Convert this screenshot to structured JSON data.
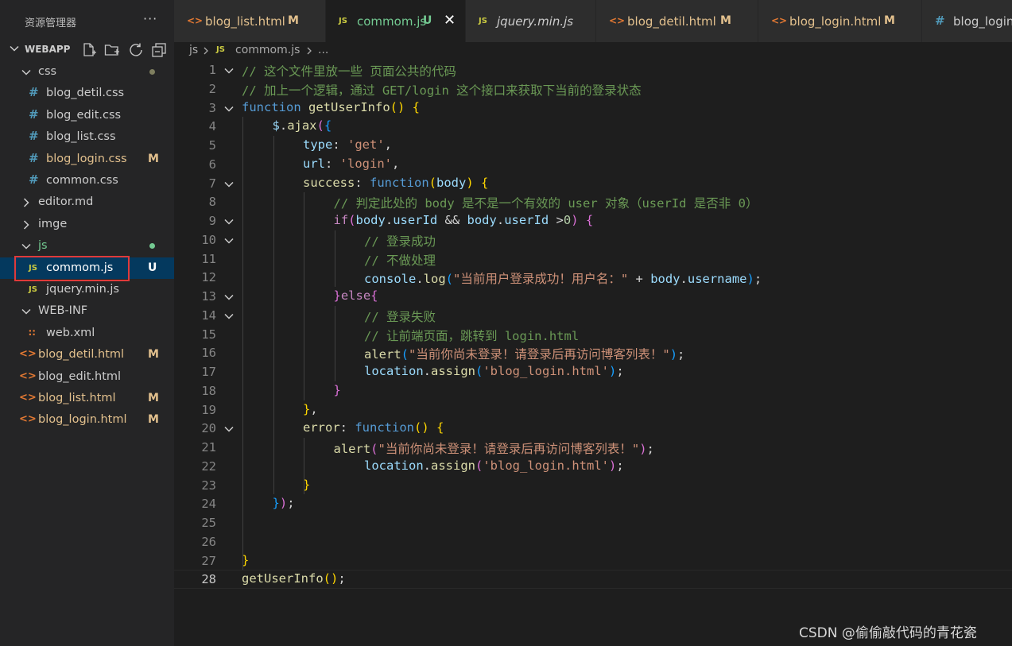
{
  "explorer": {
    "title": "资源管理器",
    "more": "···",
    "project": "WEBAPP",
    "toolbar_icons": [
      "new-file-icon",
      "new-folder-icon",
      "refresh-icon",
      "collapse-all-icon"
    ]
  },
  "tree": [
    {
      "label": "css",
      "type": "folder",
      "open": true,
      "depth": 1,
      "dot": true,
      "dot_color": "#7f7f5f"
    },
    {
      "label": "blog_detil.css",
      "type": "css",
      "depth": 2
    },
    {
      "label": "blog_edit.css",
      "type": "css",
      "depth": 2
    },
    {
      "label": "blog_list.css",
      "type": "css",
      "depth": 2
    },
    {
      "label": "blog_login.css",
      "type": "css",
      "depth": 2,
      "status": "M",
      "color": "#e2c08d"
    },
    {
      "label": "common.css",
      "type": "css",
      "depth": 2
    },
    {
      "label": "editor.md",
      "type": "folder",
      "open": false,
      "depth": 1
    },
    {
      "label": "imge",
      "type": "folder",
      "open": false,
      "depth": 1
    },
    {
      "label": "js",
      "type": "folder",
      "open": true,
      "depth": 1,
      "dot": true,
      "dot_color": "#73c991",
      "color": "#73c991"
    },
    {
      "label": "commom.js",
      "type": "js",
      "depth": 2,
      "status": "U",
      "color": "#ffffff",
      "active": true
    },
    {
      "label": "jquery.min.js",
      "type": "js",
      "depth": 2
    },
    {
      "label": "WEB-INF",
      "type": "folder",
      "open": true,
      "depth": 1
    },
    {
      "label": "web.xml",
      "type": "xml",
      "depth": 2
    },
    {
      "label": "blog_detil.html",
      "type": "html",
      "depth": 1,
      "status": "M",
      "color": "#e2c08d"
    },
    {
      "label": "blog_edit.html",
      "type": "html",
      "depth": 1
    },
    {
      "label": "blog_list.html",
      "type": "html",
      "depth": 1,
      "status": "M",
      "color": "#e2c08d"
    },
    {
      "label": "blog_login.html",
      "type": "html",
      "depth": 1,
      "status": "M",
      "color": "#e2c08d"
    }
  ],
  "tabs": [
    {
      "label": "blog_list.html",
      "icon": "html",
      "status": "M",
      "color": "#e2c08d"
    },
    {
      "label": "commom.js",
      "icon": "js",
      "status": "U",
      "color": "#73c991",
      "active": true,
      "close": "✕"
    },
    {
      "label": "jquery.min.js",
      "icon": "js",
      "italic": true
    },
    {
      "label": "blog_detil.html",
      "icon": "html",
      "status": "M",
      "color": "#e2c08d"
    },
    {
      "label": "blog_login.html",
      "icon": "html",
      "status": "M",
      "color": "#e2c08d"
    },
    {
      "label": "blog_login.css",
      "icon": "css"
    }
  ],
  "icons": {
    "js": "JS",
    "css": "#",
    "html": "<>",
    "xml": "∷"
  },
  "breadcrumb": {
    "folder": "js",
    "file": "commom.js",
    "rest": "..."
  },
  "code": {
    "current_line": 28,
    "lines": [
      {
        "n": 1,
        "fold": true,
        "indent": 0,
        "t": [
          [
            "c-cm",
            "// 这个文件里放一些 页面公共的代码"
          ]
        ]
      },
      {
        "n": 2,
        "indent": 0,
        "t": [
          [
            "c-cm",
            "// 加上一个逻辑，通过 GET/login 这个接口来获取下当前的登录状态"
          ]
        ]
      },
      {
        "n": 3,
        "fold": true,
        "indent": 0,
        "t": [
          [
            "c-kw",
            "function"
          ],
          [
            "",
            " "
          ],
          [
            "c-fn",
            "getUserInfo"
          ],
          [
            "b1",
            "()"
          ],
          [
            "",
            " "
          ],
          [
            "b1",
            "{"
          ]
        ]
      },
      {
        "n": 4,
        "indent": 1,
        "t": [
          [
            "c-pr",
            "$"
          ],
          [
            "",
            "."
          ],
          [
            "c-fn",
            "ajax"
          ],
          [
            "b2",
            "("
          ],
          [
            "b3",
            "{"
          ]
        ]
      },
      {
        "n": 5,
        "indent": 2,
        "t": [
          [
            "c-pr",
            "type"
          ],
          [
            "",
            ": "
          ],
          [
            "c-st",
            "'get'"
          ],
          [
            "",
            ","
          ]
        ]
      },
      {
        "n": 6,
        "indent": 2,
        "t": [
          [
            "c-pr",
            "url"
          ],
          [
            "",
            ": "
          ],
          [
            "c-st",
            "'login'"
          ],
          [
            "",
            ","
          ]
        ]
      },
      {
        "n": 7,
        "fold": true,
        "indent": 2,
        "t": [
          [
            "c-fn",
            "success"
          ],
          [
            "",
            ": "
          ],
          [
            "c-kw",
            "function"
          ],
          [
            "b1",
            "("
          ],
          [
            "c-pr",
            "body"
          ],
          [
            "b1",
            ")"
          ],
          [
            "",
            " "
          ],
          [
            "b1",
            "{"
          ]
        ]
      },
      {
        "n": 8,
        "indent": 3,
        "t": [
          [
            "c-cm",
            "// 判定此处的 body 是不是一个有效的 user 对象（userId 是否非 0）"
          ]
        ]
      },
      {
        "n": 9,
        "fold": true,
        "indent": 3,
        "t": [
          [
            "c-ct",
            "if"
          ],
          [
            "b2",
            "("
          ],
          [
            "c-pr",
            "body"
          ],
          [
            "",
            "."
          ],
          [
            "c-pr",
            "userId"
          ],
          [
            "",
            " && "
          ],
          [
            "c-pr",
            "body"
          ],
          [
            "",
            "."
          ],
          [
            "c-pr",
            "userId"
          ],
          [
            "",
            " >"
          ],
          [
            "c-nm",
            "0"
          ],
          [
            "b2",
            ")"
          ],
          [
            "",
            " "
          ],
          [
            "b2",
            "{"
          ]
        ]
      },
      {
        "n": 10,
        "fold": true,
        "indent": 4,
        "t": [
          [
            "c-cm",
            "// 登录成功"
          ]
        ]
      },
      {
        "n": 11,
        "indent": 4,
        "t": [
          [
            "c-cm",
            "// 不做处理"
          ]
        ]
      },
      {
        "n": 12,
        "indent": 4,
        "t": [
          [
            "c-pr",
            "console"
          ],
          [
            "",
            "."
          ],
          [
            "c-fn",
            "log"
          ],
          [
            "b3",
            "("
          ],
          [
            "c-st",
            "\"当前用户登录成功！用户名：\""
          ],
          [
            "",
            " + "
          ],
          [
            "c-pr",
            "body"
          ],
          [
            "",
            "."
          ],
          [
            "c-pr",
            "username"
          ],
          [
            "b3",
            ")"
          ],
          [
            "",
            ";"
          ]
        ]
      },
      {
        "n": 13,
        "fold": true,
        "indent": 3,
        "t": [
          [
            "b2",
            "}"
          ],
          [
            "c-ct",
            "else"
          ],
          [
            "b2",
            "{"
          ]
        ]
      },
      {
        "n": 14,
        "fold": true,
        "indent": 4,
        "t": [
          [
            "c-cm",
            "// 登录失败"
          ]
        ]
      },
      {
        "n": 15,
        "indent": 4,
        "t": [
          [
            "c-cm",
            "// 让前端页面，跳转到 login.html"
          ]
        ]
      },
      {
        "n": 16,
        "indent": 4,
        "t": [
          [
            "c-fn",
            "alert"
          ],
          [
            "b3",
            "("
          ],
          [
            "c-st",
            "\"当前你尚未登录！请登录后再访问博客列表！\""
          ],
          [
            "b3",
            ")"
          ],
          [
            "",
            ";"
          ]
        ]
      },
      {
        "n": 17,
        "indent": 4,
        "t": [
          [
            "c-pr",
            "location"
          ],
          [
            "",
            "."
          ],
          [
            "c-fn",
            "assign"
          ],
          [
            "b3",
            "("
          ],
          [
            "c-st",
            "'blog_login.html'"
          ],
          [
            "b3",
            ")"
          ],
          [
            "",
            ";"
          ]
        ]
      },
      {
        "n": 18,
        "indent": 3,
        "t": [
          [
            "b2",
            "}"
          ]
        ]
      },
      {
        "n": 19,
        "indent": 2,
        "t": [
          [
            "b1",
            "}"
          ],
          [
            "",
            ","
          ]
        ]
      },
      {
        "n": 20,
        "fold": true,
        "indent": 2,
        "t": [
          [
            "c-fn",
            "error"
          ],
          [
            "",
            ": "
          ],
          [
            "c-kw",
            "function"
          ],
          [
            "b1",
            "()"
          ],
          [
            "",
            " "
          ],
          [
            "b1",
            "{"
          ]
        ]
      },
      {
        "n": 21,
        "indent": 3,
        "t": [
          [
            "c-fn",
            "alert"
          ],
          [
            "b2",
            "("
          ],
          [
            "c-st",
            "\"当前你尚未登录！请登录后再访问博客列表！\""
          ],
          [
            "b2",
            ")"
          ],
          [
            "",
            ";"
          ]
        ]
      },
      {
        "n": 22,
        "indent": 4,
        "t": [
          [
            "c-pr",
            "location"
          ],
          [
            "",
            "."
          ],
          [
            "c-fn",
            "assign"
          ],
          [
            "b2",
            "("
          ],
          [
            "c-st",
            "'blog_login.html'"
          ],
          [
            "b2",
            ")"
          ],
          [
            "",
            ";"
          ]
        ]
      },
      {
        "n": 23,
        "indent": 2,
        "t": [
          [
            "b1",
            "}"
          ]
        ]
      },
      {
        "n": 24,
        "indent": 1,
        "t": [
          [
            "b3",
            "}"
          ],
          [
            "b2",
            ")"
          ],
          [
            "",
            ";"
          ]
        ]
      },
      {
        "n": 25,
        "indent": 0,
        "t": []
      },
      {
        "n": 26,
        "indent": 0,
        "t": []
      },
      {
        "n": 27,
        "indent": 0,
        "t": [
          [
            "b1",
            "}"
          ]
        ]
      },
      {
        "n": 28,
        "indent": 0,
        "t": [
          [
            "c-fn",
            "getUserInfo"
          ],
          [
            "b1",
            "()"
          ],
          [
            "",
            ";"
          ]
        ]
      }
    ]
  },
  "watermark": "CSDN @偷偷敲代码的青花瓷"
}
